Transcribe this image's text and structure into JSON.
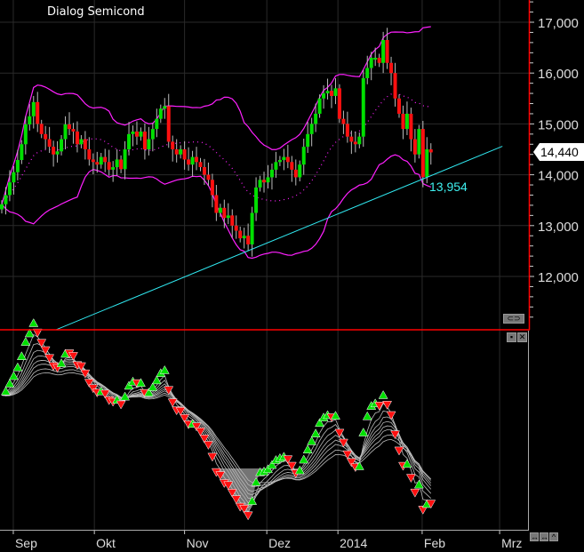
{
  "chart_data": {
    "type": "candlestick",
    "title": "Dialog Semicond",
    "closes": [
      13420,
      13600,
      13850,
      14050,
      14290,
      14600,
      14990,
      15150,
      15430,
      15000,
      14800,
      14700,
      14550,
      14400,
      14460,
      14700,
      14990,
      14900,
      14850,
      14600,
      14700,
      14500,
      14300,
      14250,
      14200,
      14350,
      14250,
      14100,
      14150,
      14300,
      14110,
      14500,
      14800,
      14850,
      14750,
      14850,
      14500,
      14700,
      14900,
      15100,
      15300,
      15350,
      14650,
      14500,
      14400,
      14500,
      14300,
      14200,
      14350,
      14250,
      14150,
      14000,
      13900,
      13600,
      13250,
      13350,
      13150,
      13200,
      13000,
      12900,
      12750,
      12800,
      12630,
      13250,
      13750,
      13900,
      13850,
      13950,
      14100,
      14250,
      14290,
      14350,
      14250,
      14100,
      13950,
      14200,
      14550,
      14800,
      15000,
      15200,
      15500,
      15600,
      15650,
      15550,
      15700,
      15100,
      15000,
      14750,
      14650,
      14600,
      14750,
      15900,
      16100,
      16300,
      16300,
      16200,
      16650,
      16200,
      16000,
      15500,
      15200,
      14900,
      15200,
      14700,
      14400,
      14900,
      13954,
      14500,
      14440
    ],
    "ylim": [
      11000,
      17400
    ],
    "y_ticks": [
      12000,
      13000,
      14000,
      15000,
      16000,
      17000
    ],
    "y_tick_labels": [
      "12,000",
      "13,000",
      "14,000",
      "15,000",
      "16,000",
      "17,000"
    ],
    "x_ticks": [
      {
        "label": "Sep",
        "index": 2.9
      },
      {
        "label": "Okt",
        "index": 23.3
      },
      {
        "label": "Nov",
        "index": 46
      },
      {
        "label": "Dez",
        "index": 66.7
      },
      {
        "label": "2014",
        "index": 84.6
      },
      {
        "label": "Feb",
        "index": 105.8
      },
      {
        "label": "Mrz",
        "index": 125.3
      }
    ],
    "bollinger": {
      "period": 20,
      "stddev": 2
    },
    "trendline": {
      "from": [
        13.6,
        10950
      ],
      "to": [
        126,
        14560
      ]
    },
    "low_annotation": "13,954",
    "last_price": "14,440",
    "colors": {
      "up": "#00e000",
      "down": "#ff1010",
      "bands": "#ff20ff",
      "trend": "#30e8f0",
      "axis": "#ff0000",
      "grid": "#2a2a2a"
    }
  }
}
